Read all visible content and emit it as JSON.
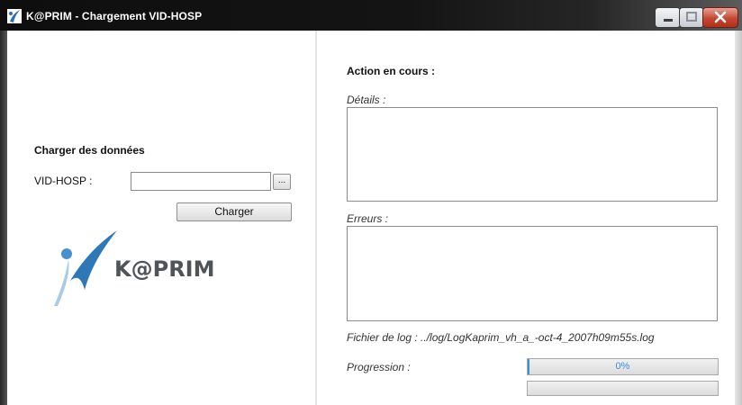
{
  "window": {
    "title": "K@PRIM - Chargement VID-HOSP",
    "controls": {
      "minimize_icon": "minimize-icon",
      "maximize_icon": "maximize-icon",
      "close_icon": "close-icon"
    }
  },
  "left_panel": {
    "section_title": "Charger des données",
    "vidhosp_label": "VID-HOSP :",
    "vidhosp_value": "",
    "browse_label": "...",
    "load_button": "Charger",
    "logo_text": "K@PRIM"
  },
  "right_panel": {
    "action_title": "Action en cours :",
    "details_label": "Détails :",
    "details_text": "",
    "errors_label": "Erreurs :",
    "errors_text": "",
    "log_label": "Fichier de log : ../log/LogKaprim_vh_a_-oct-4_2007h09m55s.log",
    "progress_label": "Progression :",
    "progress_text": "0%",
    "progress_value": 0.0,
    "secondary_progress_value": 0.0
  },
  "colors": {
    "accent": "#3b8fe0",
    "titlebar": "#141414",
    "close": "#c44832"
  }
}
